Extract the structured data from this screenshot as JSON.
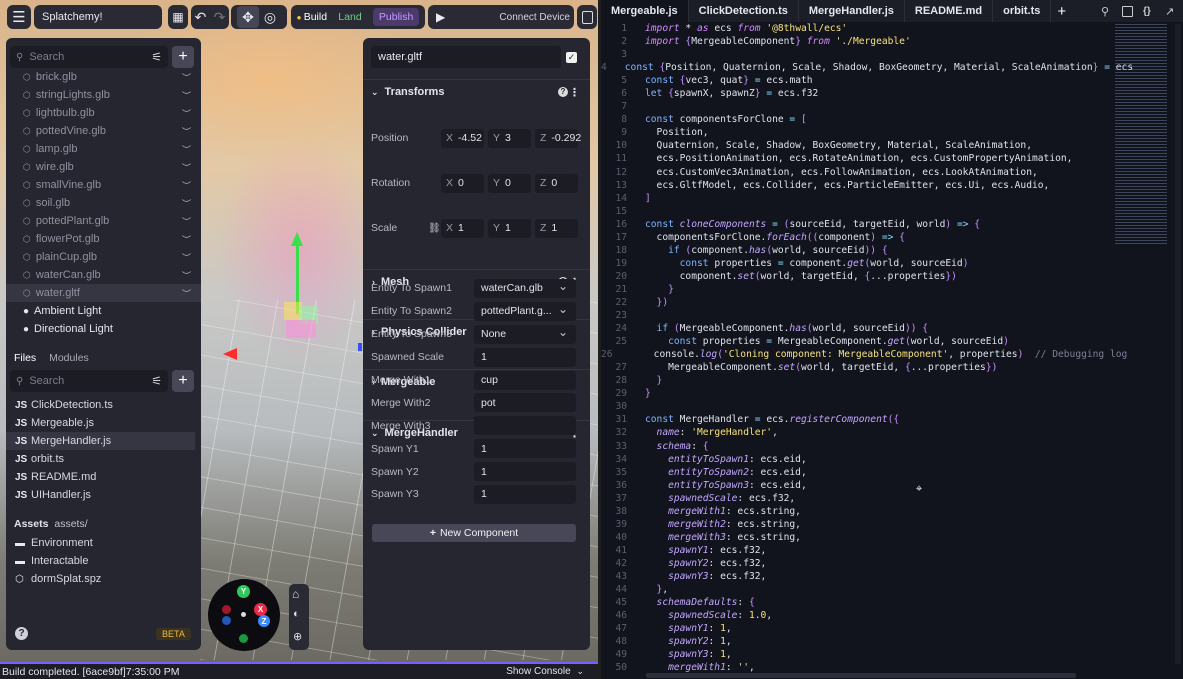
{
  "toolbar": {
    "menu_icon": "hamburger-icon",
    "project_name": "Splatchemy!",
    "map_icon": "map-icon",
    "undo_icon": "undo-icon",
    "redo_icon": "redo-icon",
    "move_icon": "move-icon",
    "orbit_icon": "orbit-icon",
    "build_label": "Build",
    "land_label": "Land",
    "publish_label": "Publish",
    "play_icon": "play-icon",
    "connect_label": "Connect Device",
    "build_color": "#f5c542",
    "land_color": "#6fd18a",
    "publish_color": "#c39bff"
  },
  "hierarchy": {
    "search_placeholder": "Search",
    "items": [
      {
        "label": "brick.glb"
      },
      {
        "label": "stringLights.glb"
      },
      {
        "label": "lightbulb.glb"
      },
      {
        "label": "pottedVine.glb"
      },
      {
        "label": "lamp.glb"
      },
      {
        "label": "wire.glb"
      },
      {
        "label": "smallVine.glb"
      },
      {
        "label": "soil.glb"
      },
      {
        "label": "pottedPlant.glb"
      },
      {
        "label": "flowerPot.glb"
      },
      {
        "label": "plainCup.glb"
      },
      {
        "label": "waterCan.glb"
      },
      {
        "label": "water.gltf"
      }
    ],
    "lights": [
      {
        "label": "Ambient Light"
      },
      {
        "label": "Directional Light"
      }
    ]
  },
  "files": {
    "tab_files": "Files",
    "tab_modules": "Modules",
    "search_placeholder": "Search",
    "items": [
      {
        "type": "JS",
        "label": "ClickDetection.ts"
      },
      {
        "type": "JS",
        "label": "Mergeable.js"
      },
      {
        "type": "JS",
        "label": "MergeHandler.js"
      },
      {
        "type": "JS",
        "label": "orbit.ts"
      },
      {
        "type": "JS",
        "label": "README.md"
      },
      {
        "type": "JS",
        "label": "UIHandler.js"
      }
    ],
    "assets_label": "Assets",
    "assets_path": "assets/",
    "asset_items": [
      {
        "label": "Environment"
      },
      {
        "label": "Interactable"
      },
      {
        "label": "dormSplat.spz"
      }
    ],
    "beta_label": "BETA"
  },
  "inspector": {
    "entity_name": "water.gltf",
    "transforms_label": "Transforms",
    "position_label": "Position",
    "rotation_label": "Rotation",
    "scale_label": "Scale",
    "position": {
      "x": "-4.52",
      "y": "3",
      "z": "-0.292"
    },
    "rotation": {
      "x": "0",
      "y": "0",
      "z": "0"
    },
    "scale": {
      "x": "1",
      "y": "1",
      "z": "1"
    },
    "axis_x": "X",
    "axis_y": "Y",
    "axis_z": "Z",
    "mesh_label": "Mesh",
    "physics_label": "Physics Collider",
    "mergeable_label": "Mergeable",
    "mergehandler_label": "MergeHandler",
    "props": [
      {
        "label": "Entity To Spawn1",
        "value": "waterCan.glb",
        "dropdown": true
      },
      {
        "label": "Entity To Spawn2",
        "value": "pottedPlant.g...",
        "dropdown": true
      },
      {
        "label": "Entity To Spawn3",
        "value": "None",
        "dropdown": true
      },
      {
        "label": "Spawned Scale",
        "value": "1"
      },
      {
        "label": "Merge With1",
        "value": "cup"
      },
      {
        "label": "Merge With2",
        "value": "pot"
      },
      {
        "label": "Merge With3",
        "value": ""
      },
      {
        "label": "Spawn Y1",
        "value": "1"
      },
      {
        "label": "Spawn Y2",
        "value": "1"
      },
      {
        "label": "Spawn Y3",
        "value": "1"
      }
    ],
    "new_component_label": "New Component"
  },
  "gizmo": {
    "y_label": "Y",
    "x_label": "X",
    "z_label": "Z"
  },
  "status": {
    "message": "Build completed. [6ace9bf]7:35:00 PM",
    "console_label": "Show Console"
  },
  "editor": {
    "tabs": [
      {
        "label": "Mergeable.js"
      },
      {
        "label": "ClickDetection.ts"
      },
      {
        "label": "MergeHandler.js"
      },
      {
        "label": "README.md"
      },
      {
        "label": "orbit.ts"
      }
    ],
    "lines": [
      {
        "n": "1",
        "parts": [
          [
            "kwi",
            "import"
          ],
          [
            "plain",
            " * "
          ],
          [
            "kwi",
            "as"
          ],
          [
            "plain",
            " ecs "
          ],
          [
            "kwi",
            "from"
          ],
          [
            "str",
            " '@8thwall/ecs'"
          ]
        ]
      },
      {
        "n": "2",
        "parts": [
          [
            "kwi",
            "import"
          ],
          [
            "br",
            " {"
          ],
          [
            "plain",
            "MergeableComponent"
          ],
          [
            "br",
            "}"
          ],
          [
            "kwi",
            " from"
          ],
          [
            "str",
            " './Mergeable'"
          ]
        ]
      },
      {
        "n": "3",
        "parts": []
      },
      {
        "n": "4",
        "parts": [
          [
            "kw",
            "const"
          ],
          [
            "br",
            " {"
          ],
          [
            "plain",
            "Position, Quaternion, Scale, Shadow, BoxGeometry, Material, ScaleAnimation"
          ],
          [
            "br",
            "}"
          ],
          [
            "op",
            " ="
          ],
          [
            "plain",
            " ecs"
          ]
        ]
      },
      {
        "n": "5",
        "parts": [
          [
            "kw",
            "const"
          ],
          [
            "br",
            " {"
          ],
          [
            "plain",
            "vec3, quat"
          ],
          [
            "br",
            "}"
          ],
          [
            "op",
            " ="
          ],
          [
            "plain",
            " ecs.math"
          ]
        ]
      },
      {
        "n": "6",
        "parts": [
          [
            "kw",
            "let"
          ],
          [
            "br",
            " {"
          ],
          [
            "plain",
            "spawnX, spawnZ"
          ],
          [
            "br",
            "}"
          ],
          [
            "op",
            " ="
          ],
          [
            "plain",
            " ecs.f32"
          ]
        ]
      },
      {
        "n": "7",
        "parts": []
      },
      {
        "n": "8",
        "parts": [
          [
            "kw",
            "const"
          ],
          [
            "plain",
            " componentsForClone "
          ],
          [
            "op",
            "="
          ],
          [
            "br",
            " ["
          ]
        ]
      },
      {
        "n": "9",
        "parts": [
          [
            "plain",
            "  Position,"
          ]
        ]
      },
      {
        "n": "10",
        "parts": [
          [
            "plain",
            "  Quaternion, Scale, Shadow, BoxGeometry, Material, ScaleAnimation,"
          ]
        ]
      },
      {
        "n": "11",
        "parts": [
          [
            "plain",
            "  ecs.PositionAnimation, ecs.RotateAnimation, ecs.CustomPropertyAnimation,"
          ]
        ]
      },
      {
        "n": "12",
        "parts": [
          [
            "plain",
            "  ecs.CustomVec3Animation, ecs.FollowAnimation, ecs.LookAtAnimation,"
          ]
        ]
      },
      {
        "n": "13",
        "parts": [
          [
            "plain",
            "  ecs.GltfModel, ecs.Collider, ecs.ParticleEmitter, ecs.Ui, ecs.Audio,"
          ]
        ]
      },
      {
        "n": "14",
        "parts": [
          [
            "br",
            "]"
          ]
        ]
      },
      {
        "n": "15",
        "parts": []
      },
      {
        "n": "16",
        "parts": [
          [
            "kw",
            "const"
          ],
          [
            "fn",
            " cloneComponents"
          ],
          [
            "op",
            " ="
          ],
          [
            "br",
            " ("
          ],
          [
            "plain",
            "sourceEid, targetEid, world"
          ],
          [
            "br",
            ")"
          ],
          [
            "op",
            " =>"
          ],
          [
            "br",
            " {"
          ]
        ]
      },
      {
        "n": "17",
        "parts": [
          [
            "plain",
            "  componentsForClone."
          ],
          [
            "fn",
            "forEach"
          ],
          [
            "br",
            "(("
          ],
          [
            "plain",
            "component"
          ],
          [
            "br",
            ")"
          ],
          [
            "op",
            " =>"
          ],
          [
            "br",
            " {"
          ]
        ]
      },
      {
        "n": "18",
        "parts": [
          [
            "kw",
            "    if"
          ],
          [
            "br",
            " ("
          ],
          [
            "plain",
            "component."
          ],
          [
            "fn",
            "has"
          ],
          [
            "br",
            "("
          ],
          [
            "plain",
            "world, sourceEid"
          ],
          [
            "br",
            "))"
          ],
          [
            "br",
            " {"
          ]
        ]
      },
      {
        "n": "19",
        "parts": [
          [
            "kw",
            "      const"
          ],
          [
            "plain",
            " properties "
          ],
          [
            "op",
            "="
          ],
          [
            "plain",
            " component."
          ],
          [
            "fn",
            "get"
          ],
          [
            "br",
            "("
          ],
          [
            "plain",
            "world, sourceEid"
          ],
          [
            "br",
            ")"
          ]
        ]
      },
      {
        "n": "20",
        "parts": [
          [
            "plain",
            "      component."
          ],
          [
            "fn",
            "set"
          ],
          [
            "br",
            "("
          ],
          [
            "plain",
            "world, targetEid, "
          ],
          [
            "br",
            "{"
          ],
          [
            "plain",
            "...properties"
          ],
          [
            "br",
            "})"
          ]
        ]
      },
      {
        "n": "21",
        "parts": [
          [
            "br",
            "    }"
          ]
        ]
      },
      {
        "n": "22",
        "parts": [
          [
            "br",
            "  })"
          ]
        ]
      },
      {
        "n": "23",
        "parts": []
      },
      {
        "n": "24",
        "parts": [
          [
            "kw",
            "  if"
          ],
          [
            "br",
            " ("
          ],
          [
            "plain",
            "MergeableComponent."
          ],
          [
            "fn",
            "has"
          ],
          [
            "br",
            "("
          ],
          [
            "plain",
            "world, sourceEid"
          ],
          [
            "br",
            "))"
          ],
          [
            "br",
            " {"
          ]
        ]
      },
      {
        "n": "25",
        "parts": [
          [
            "kw",
            "    const"
          ],
          [
            "plain",
            " properties "
          ],
          [
            "op",
            "="
          ],
          [
            "plain",
            " MergeableComponent."
          ],
          [
            "fn",
            "get"
          ],
          [
            "br",
            "("
          ],
          [
            "plain",
            "world, sourceEid"
          ],
          [
            "br",
            ")"
          ]
        ]
      },
      {
        "n": "26",
        "parts": [
          [
            "plain",
            "    console."
          ],
          [
            "fn",
            "log"
          ],
          [
            "br",
            "("
          ],
          [
            "str",
            "'Cloning component: MergeableComponent'"
          ],
          [
            "plain",
            ", properties"
          ],
          [
            "br",
            ")"
          ],
          [
            "cm",
            "  // Debugging log"
          ]
        ]
      },
      {
        "n": "27",
        "parts": [
          [
            "plain",
            "    MergeableComponent."
          ],
          [
            "fn",
            "set"
          ],
          [
            "br",
            "("
          ],
          [
            "plain",
            "world, targetEid, "
          ],
          [
            "br",
            "{"
          ],
          [
            "plain",
            "...properties"
          ],
          [
            "br",
            "})"
          ]
        ]
      },
      {
        "n": "28",
        "parts": [
          [
            "br",
            "  }"
          ]
        ]
      },
      {
        "n": "29",
        "parts": [
          [
            "br",
            "}"
          ]
        ]
      },
      {
        "n": "30",
        "parts": []
      },
      {
        "n": "31",
        "parts": [
          [
            "kw",
            "const"
          ],
          [
            "plain",
            " MergeHandler "
          ],
          [
            "op",
            "="
          ],
          [
            "plain",
            " ecs."
          ],
          [
            "fn",
            "registerComponent"
          ],
          [
            "br",
            "({"
          ]
        ]
      },
      {
        "n": "32",
        "parts": [
          [
            "fn",
            "  name"
          ],
          [
            "plain",
            ": "
          ],
          [
            "str",
            "'MergeHandler'"
          ],
          [
            "plain",
            ","
          ]
        ]
      },
      {
        "n": "33",
        "parts": [
          [
            "fn",
            "  schema"
          ],
          [
            "plain",
            ": "
          ],
          [
            "br",
            "{"
          ]
        ]
      },
      {
        "n": "34",
        "parts": [
          [
            "fn",
            "    entityToSpawn1"
          ],
          [
            "plain",
            ": ecs.eid,"
          ]
        ]
      },
      {
        "n": "35",
        "parts": [
          [
            "fn",
            "    entityToSpawn2"
          ],
          [
            "plain",
            ": ecs.eid,"
          ]
        ]
      },
      {
        "n": "36",
        "parts": [
          [
            "fn",
            "    entityToSpawn3"
          ],
          [
            "plain",
            ": ecs.eid,"
          ]
        ]
      },
      {
        "n": "37",
        "parts": [
          [
            "fn",
            "    spawnedScale"
          ],
          [
            "plain",
            ": ecs.f32,"
          ]
        ]
      },
      {
        "n": "38",
        "parts": [
          [
            "fn",
            "    mergeWith1"
          ],
          [
            "plain",
            ": ecs.string,"
          ]
        ]
      },
      {
        "n": "39",
        "parts": [
          [
            "fn",
            "    mergeWith2"
          ],
          [
            "plain",
            ": ecs.string,"
          ]
        ]
      },
      {
        "n": "40",
        "parts": [
          [
            "fn",
            "    mergeWith3"
          ],
          [
            "plain",
            ": ecs.string,"
          ]
        ]
      },
      {
        "n": "41",
        "parts": [
          [
            "fn",
            "    spawnY1"
          ],
          [
            "plain",
            ": ecs.f32,"
          ]
        ]
      },
      {
        "n": "42",
        "parts": [
          [
            "fn",
            "    spawnY2"
          ],
          [
            "plain",
            ": ecs.f32,"
          ]
        ]
      },
      {
        "n": "43",
        "parts": [
          [
            "fn",
            "    spawnY3"
          ],
          [
            "plain",
            ": ecs.f32,"
          ]
        ]
      },
      {
        "n": "44",
        "parts": [
          [
            "br",
            "  }"
          ],
          [
            "plain",
            ","
          ]
        ]
      },
      {
        "n": "45",
        "parts": [
          [
            "fn",
            "  schemaDefaults"
          ],
          [
            "plain",
            ": "
          ],
          [
            "br",
            "{"
          ]
        ]
      },
      {
        "n": "46",
        "parts": [
          [
            "fn",
            "    spawnedScale"
          ],
          [
            "plain",
            ": "
          ],
          [
            "str",
            "1.0"
          ],
          [
            "plain",
            ","
          ]
        ]
      },
      {
        "n": "47",
        "parts": [
          [
            "fn",
            "    spawnY1"
          ],
          [
            "plain",
            ": "
          ],
          [
            "str",
            "1"
          ],
          [
            "plain",
            ","
          ]
        ]
      },
      {
        "n": "48",
        "parts": [
          [
            "fn",
            "    spawnY2"
          ],
          [
            "plain",
            ": "
          ],
          [
            "str",
            "1"
          ],
          [
            "plain",
            ","
          ]
        ]
      },
      {
        "n": "49",
        "parts": [
          [
            "fn",
            "    spawnY3"
          ],
          [
            "plain",
            ": "
          ],
          [
            "str",
            "1"
          ],
          [
            "plain",
            ","
          ]
        ]
      },
      {
        "n": "50",
        "parts": [
          [
            "fn",
            "    mergeWith1"
          ],
          [
            "plain",
            ": "
          ],
          [
            "str",
            "''"
          ],
          [
            "plain",
            ","
          ]
        ]
      }
    ]
  }
}
